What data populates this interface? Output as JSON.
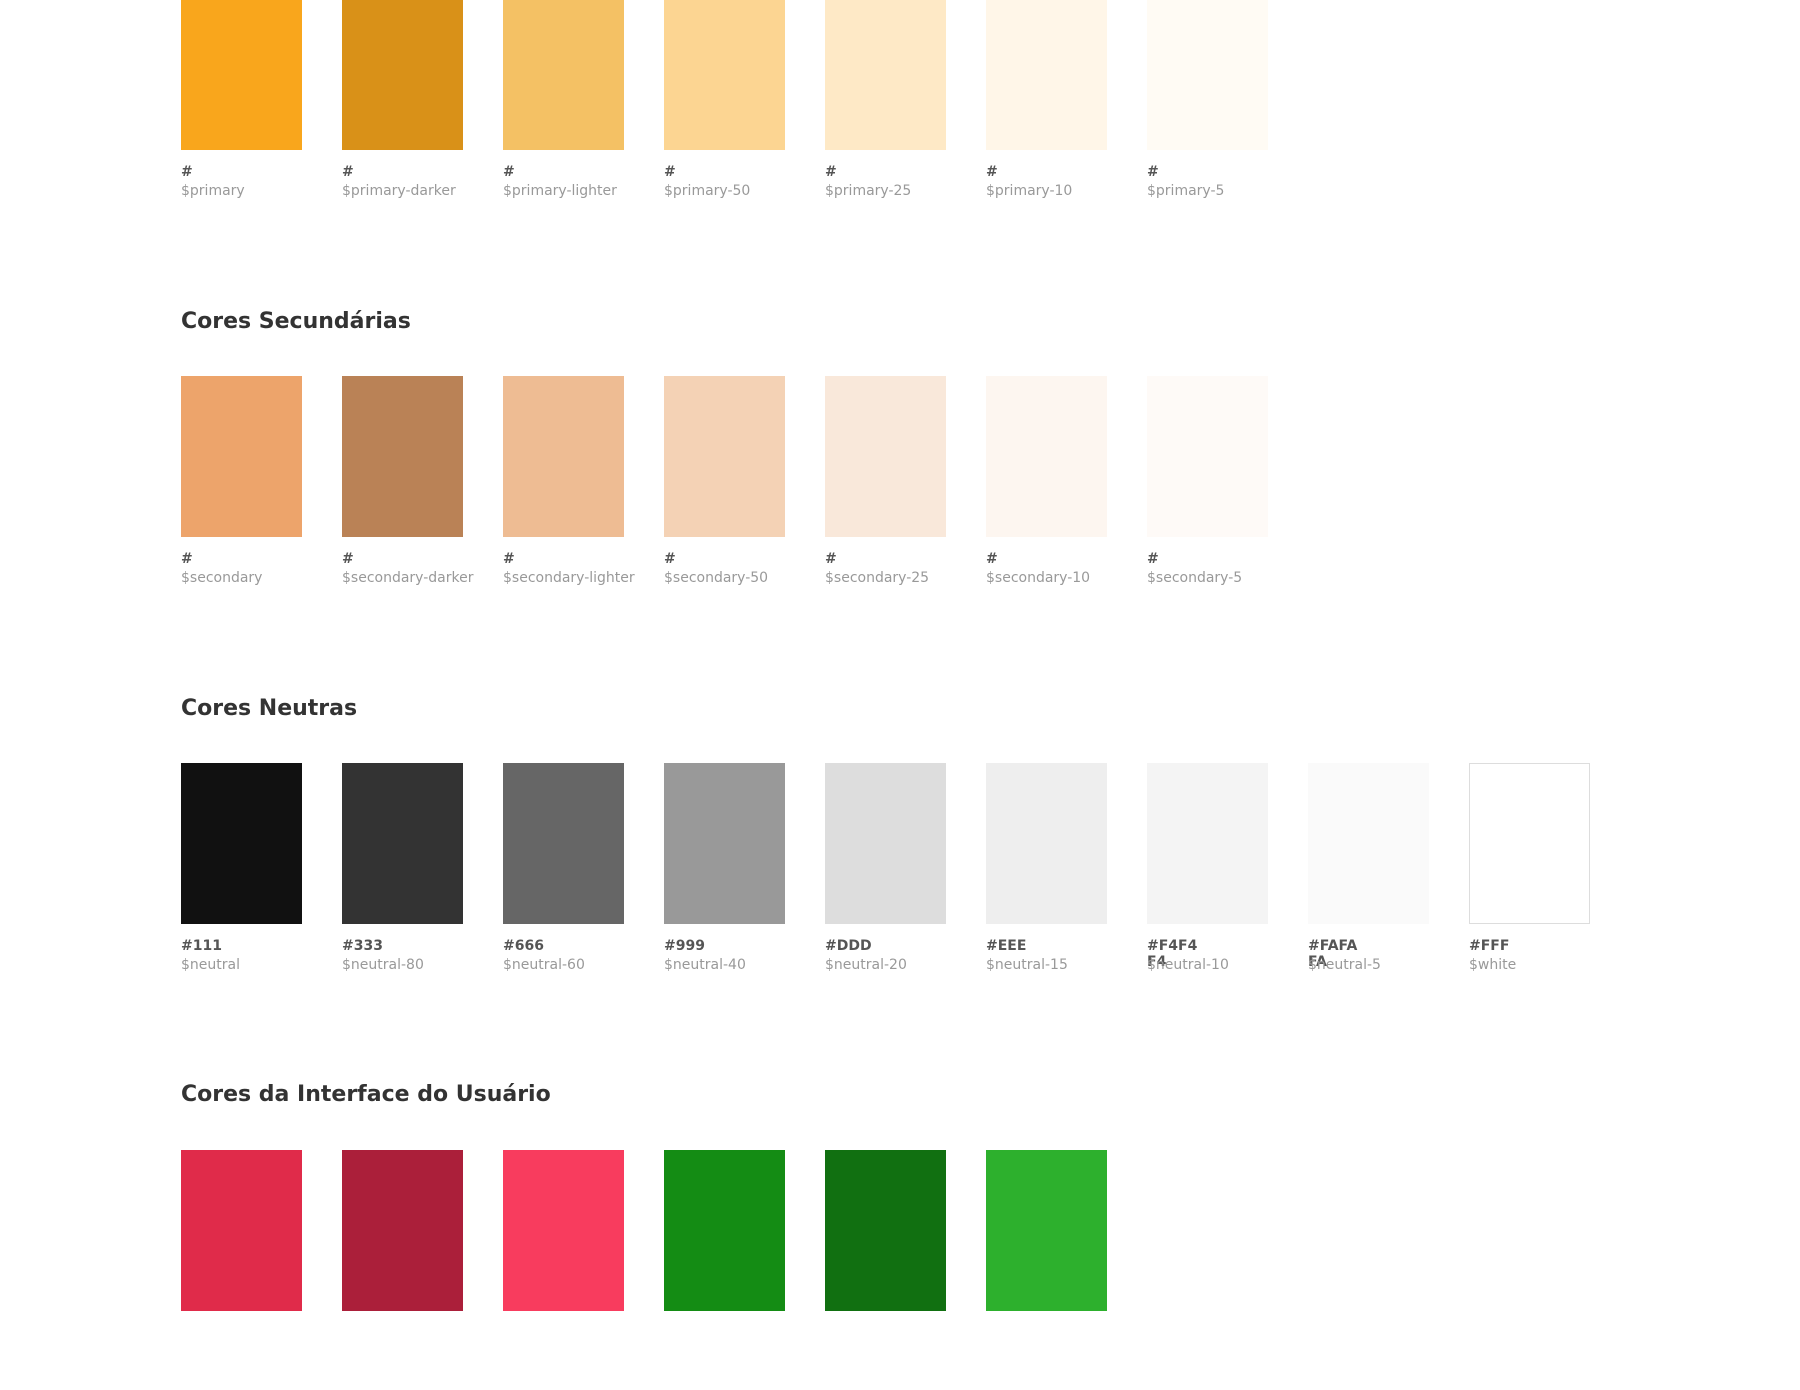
{
  "sections": [
    {
      "title": "",
      "swatches": [
        {
          "hex": "#",
          "token": "$primary",
          "color": "#F9A61C"
        },
        {
          "hex": "#",
          "token": "$primary-darker",
          "color": "#D99118"
        },
        {
          "hex": "#",
          "token": "$primary-lighter",
          "color": "#F4C164"
        },
        {
          "hex": "#",
          "token": "$primary-50",
          "color": "#FCD592"
        },
        {
          "hex": "#",
          "token": "$primary-25",
          "color": "#FEE9C6"
        },
        {
          "hex": "#",
          "token": "$primary-10",
          "color": "#FFF6E8"
        },
        {
          "hex": "#",
          "token": "$primary-5",
          "color": "#FFFBF4"
        }
      ]
    },
    {
      "title": "Cores Secundárias",
      "swatches": [
        {
          "hex": "#",
          "token": "$secondary",
          "color": "#EDA46B"
        },
        {
          "hex": "#",
          "token": "$secondary-darker",
          "color": "#BA8256"
        },
        {
          "hex": "#",
          "token": "$secondary-lighter",
          "color": "#EEBC93"
        },
        {
          "hex": "#",
          "token": "$secondary-50",
          "color": "#F4D2B5"
        },
        {
          "hex": "#",
          "token": "$secondary-25",
          "color": "#F9E8DA"
        },
        {
          "hex": "#",
          "token": "$secondary-10",
          "color": "#FDF6F0"
        },
        {
          "hex": "#",
          "token": "$secondary-5",
          "color": "#FEFAF7"
        }
      ]
    },
    {
      "title": "Cores Neutras",
      "swatches": [
        {
          "hex": "#111",
          "token": "$neutral",
          "color": "#111111"
        },
        {
          "hex": "#333",
          "token": "$neutral-80",
          "color": "#333333"
        },
        {
          "hex": "#666",
          "token": "$neutral-60",
          "color": "#666666"
        },
        {
          "hex": "#999",
          "token": "$neutral-40",
          "color": "#999999"
        },
        {
          "hex": "#DDD",
          "token": "$neutral-20",
          "color": "#DDDDDD"
        },
        {
          "hex": "#EEE",
          "token": "$neutral-15",
          "color": "#EEEEEE"
        },
        {
          "hex": "#F4F4F4",
          "token": "$neutral-10",
          "color": "#F4F4F4"
        },
        {
          "hex": "#FAFAFA",
          "token": "$neutral-5",
          "color": "#FAFAFA"
        },
        {
          "hex": "#FFF",
          "token": "$white",
          "color": "#FFFFFF",
          "bordered": true
        }
      ]
    },
    {
      "title": "Cores da Interface do Usuário",
      "swatches": [
        {
          "color": "#E02B4A"
        },
        {
          "color": "#AB1F3A"
        },
        {
          "color": "#F83C5E"
        },
        {
          "color": "#148C14"
        },
        {
          "color": "#117011"
        },
        {
          "color": "#2DB02D"
        }
      ]
    }
  ]
}
